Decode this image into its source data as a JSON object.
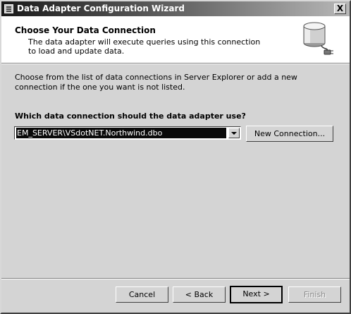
{
  "window": {
    "title": "Data Adapter Configuration Wizard",
    "close_glyph": "X"
  },
  "header": {
    "title": "Choose Your Data Connection",
    "description": "The data adapter will execute queries using this connection to load and update data.",
    "icon": "database-plug-icon"
  },
  "body": {
    "intro": "Choose from the list of data connections in Server Explorer or add a new connection if the one you want is not listed.",
    "question": "Which data connection should the data adapter use?",
    "connection_select": {
      "value": "EM_SERVER\\VSdotNET.Northwind.dbo"
    },
    "new_connection_label": "New Connection..."
  },
  "footer": {
    "cancel_label": "Cancel",
    "back_label": "< Back",
    "next_label": "Next >",
    "finish_label": "Finish"
  },
  "colors": {
    "titlebar_start": "#1a1a1a",
    "dialog_background": "#d4d4d4",
    "selection": "#0a0a0a"
  }
}
